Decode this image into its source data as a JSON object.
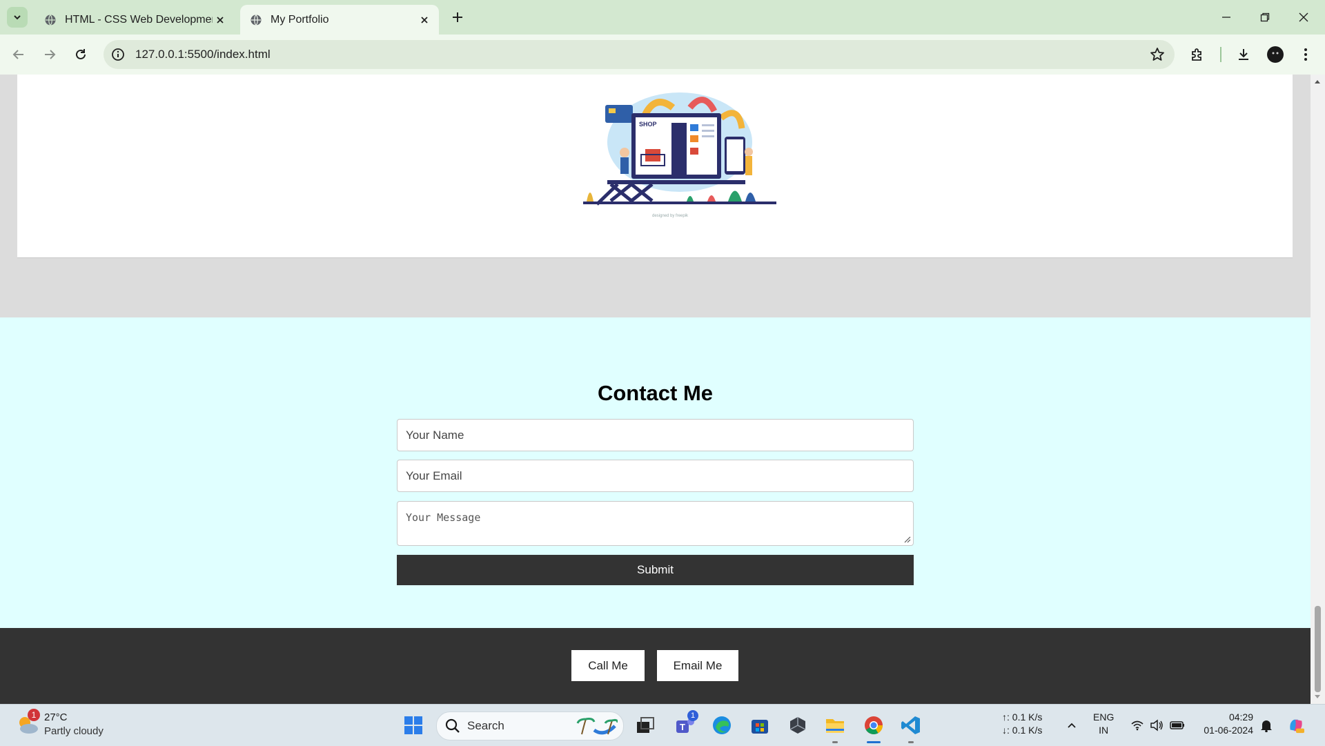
{
  "browser": {
    "tabs": [
      {
        "title": "HTML - CSS Web Development",
        "active": false
      },
      {
        "title": "My Portfolio",
        "active": true
      }
    ],
    "url": "127.0.0.1:5500/index.html"
  },
  "page": {
    "illustration": {
      "label": "SHOP"
    },
    "contact": {
      "heading": "Contact Me",
      "name_placeholder": "Your Name",
      "email_placeholder": "Your Email",
      "message_placeholder": "Your Message",
      "submit_label": "Submit"
    },
    "footer": {
      "call_label": "Call Me",
      "email_label": "Email Me"
    }
  },
  "taskbar": {
    "weather": {
      "temp": "27°C",
      "condition": "Partly cloudy",
      "badge": "1"
    },
    "search_label": "Search",
    "teams_badge": "1",
    "net_up": "↑: 0.1 K/s",
    "net_down": "↓: 0.1 K/s",
    "lang_top": "ENG",
    "lang_bottom": "IN",
    "time": "04:29",
    "date": "01-06-2024"
  }
}
